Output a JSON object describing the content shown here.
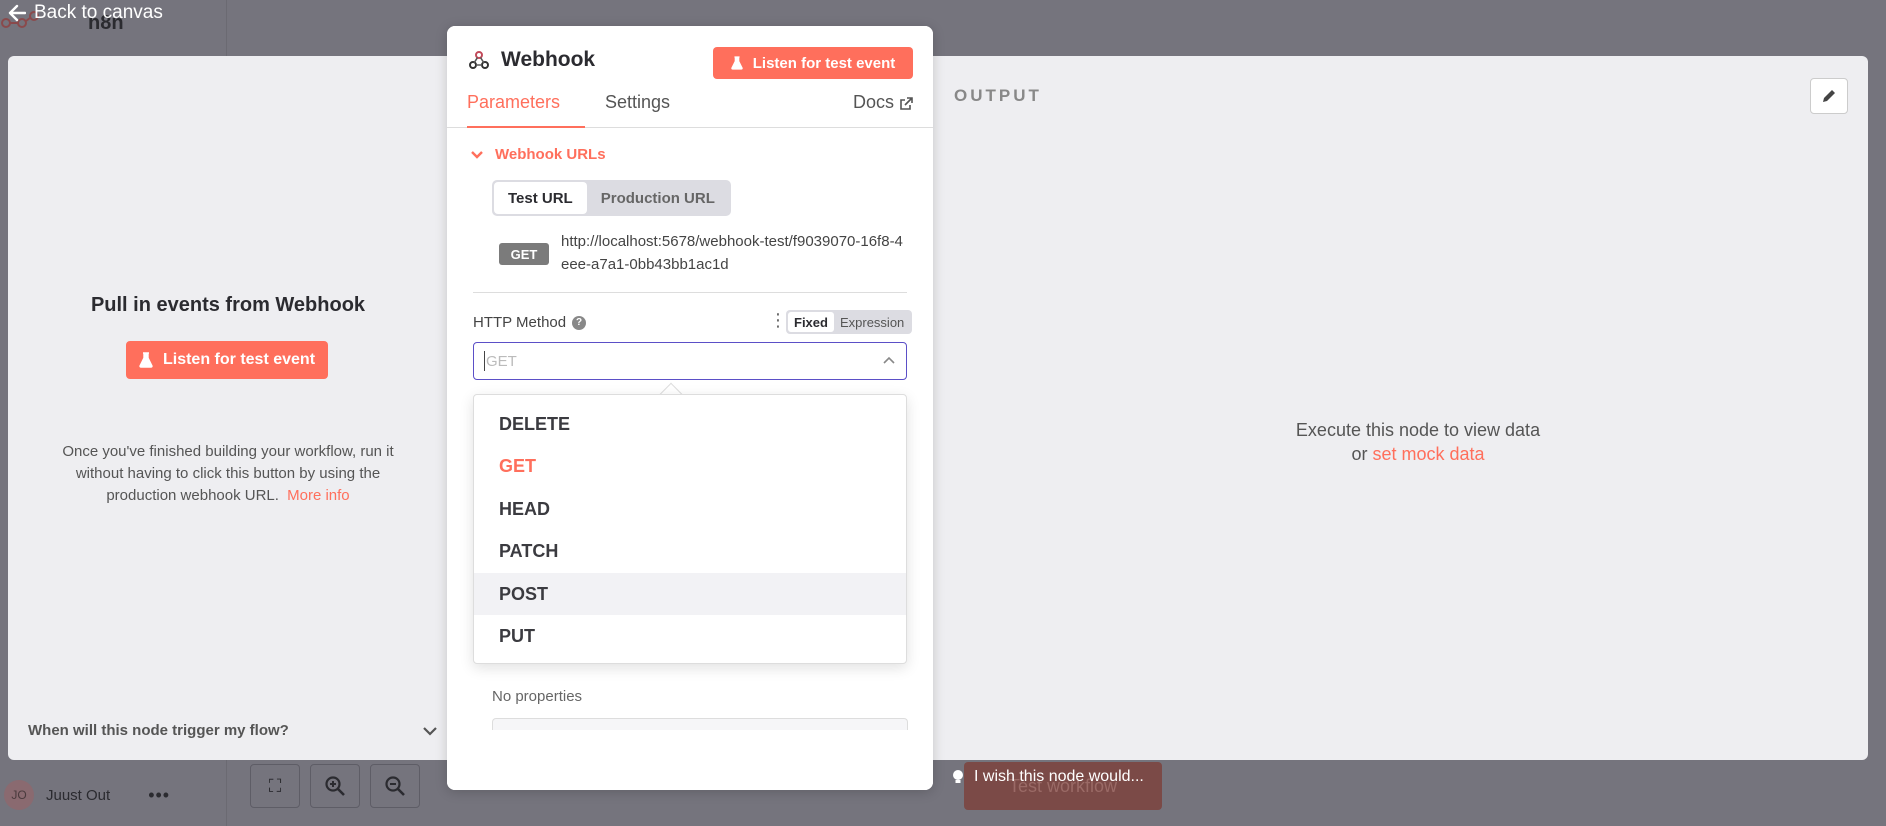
{
  "app": {
    "logo_text": "n8n",
    "back_label": "Back to canvas",
    "user_initials": "JO",
    "user_name": "Juust Out",
    "user_menu": "•••",
    "bg_test_label": "Test workflow"
  },
  "input_pane": {
    "title": "Pull in events from Webhook",
    "listen_label": "Listen for test event",
    "description": "Once you've finished building your workflow, run it without having to click this button by using the production webhook URL.",
    "more_info": "More info",
    "faq": "When will this node trigger my flow?"
  },
  "node": {
    "title": "Webhook",
    "listen_label": "Listen for test event",
    "tabs": {
      "parameters": "Parameters",
      "settings": "Settings",
      "docs": "Docs"
    },
    "webhook_urls_label": "Webhook URLs",
    "url_tabs": {
      "test": "Test URL",
      "production": "Production URL"
    },
    "url_method": "GET",
    "url": "http://localhost:5678/webhook-test/f9039070-16f8-4eee-a7a1-0bb43bb1ac1d",
    "http_method_label": "HTTP Method",
    "help": "?",
    "mode_fixed": "Fixed",
    "mode_expression": "Expression",
    "select_placeholder": "GET",
    "options": [
      "DELETE",
      "GET",
      "HEAD",
      "PATCH",
      "POST",
      "PUT"
    ],
    "selected_option": "GET",
    "hovered_option": "POST",
    "no_properties": "No properties"
  },
  "output_pane": {
    "label": "OUTPUT",
    "empty_line1": "Execute this node to view data",
    "empty_or": "or",
    "mock_link": "set mock data"
  },
  "feedback": "I wish this node would...",
  "colors": {
    "accent": "#ff6f5c",
    "focus": "#5b4fc7"
  }
}
